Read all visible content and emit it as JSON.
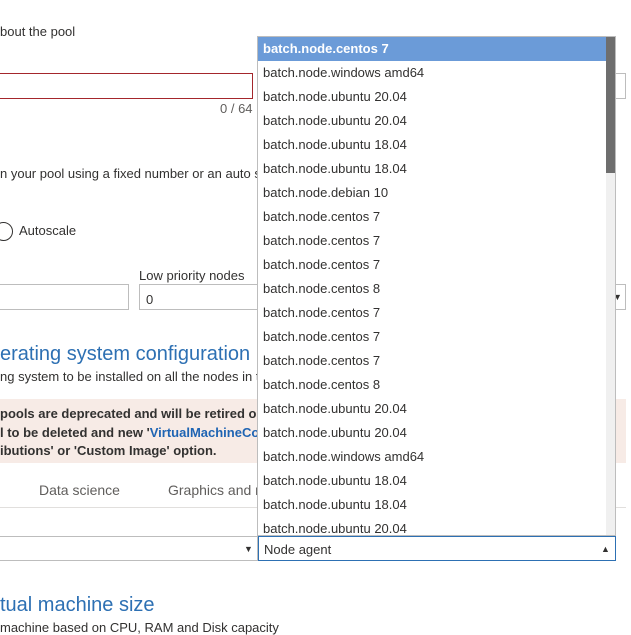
{
  "pool_info": {
    "description_fragment": "bout the pool",
    "char_count": "0 / 64"
  },
  "scale": {
    "description": "n your pool using a fixed number or an auto s",
    "autoscale_label": "Autoscale",
    "low_priority_label": "Low priority nodes",
    "low_priority_value": "0"
  },
  "os_config": {
    "heading": "erating system configuration",
    "subtext": "ng system to be installed on all the nodes in t",
    "warning_line1": " pools are deprecated and will be retired on",
    "warning_line2_prefix": "l to be deleted and new '",
    "warning_link": "VirtualMachineCon",
    "warning_line3": "ibutions' or 'Custom Image' option.",
    "tabs": [
      "Data science",
      "Graphics and r"
    ]
  },
  "node_agent": {
    "selected_label": "Node agent",
    "options": [
      "batch.node.centos 7",
      "batch.node.windows amd64",
      "batch.node.ubuntu 20.04",
      "batch.node.ubuntu 20.04",
      "batch.node.ubuntu 18.04",
      "batch.node.ubuntu 18.04",
      "batch.node.debian 10",
      "batch.node.centos 7",
      "batch.node.centos 7",
      "batch.node.centos 7",
      "batch.node.centos 8",
      "batch.node.centos 7",
      "batch.node.centos 7",
      "batch.node.centos 7",
      "batch.node.centos 8",
      "batch.node.ubuntu 20.04",
      "batch.node.ubuntu 20.04",
      "batch.node.windows amd64",
      "batch.node.ubuntu 18.04",
      "batch.node.ubuntu 18.04",
      "batch.node.ubuntu 20.04"
    ],
    "highlighted_index": 0
  },
  "vm_size": {
    "heading": "tual machine size",
    "subtext": "machine based on CPU, RAM and Disk capacity"
  },
  "colors": {
    "accent": "#2d70b3",
    "highlight": "#6b9bd8",
    "warning_bg": "#f7ebe6",
    "error_border": "#a4262c"
  }
}
